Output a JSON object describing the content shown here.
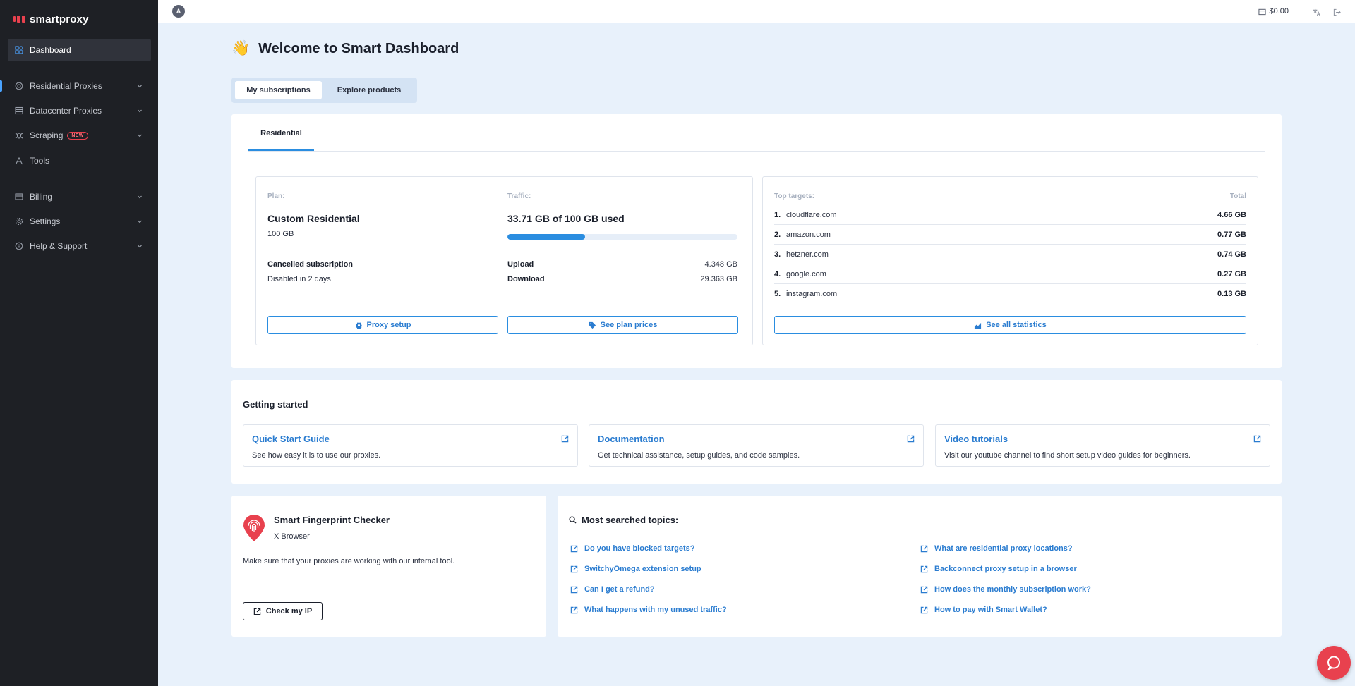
{
  "brand": {
    "name": "smartproxy",
    "accent": "#e8414e",
    "link_color": "#2a7cd0"
  },
  "sidebar": {
    "items": [
      {
        "label": "Dashboard",
        "icon": "dashboard-icon"
      },
      {
        "label": "Residential Proxies",
        "icon": "residential-icon"
      },
      {
        "label": "Datacenter Proxies",
        "icon": "datacenter-icon"
      },
      {
        "label": "Scraping",
        "icon": "scraping-icon",
        "badge": "NEW"
      },
      {
        "label": "Tools",
        "icon": "tools-icon"
      },
      {
        "label": "Billing",
        "icon": "billing-icon"
      },
      {
        "label": "Settings",
        "icon": "settings-icon"
      },
      {
        "label": "Help & Support",
        "icon": "help-icon"
      }
    ]
  },
  "topbar": {
    "avatar_initial": "A",
    "balance": "$0.00"
  },
  "welcome": {
    "emoji": "👋",
    "title": "Welcome to Smart Dashboard"
  },
  "tabs": [
    "My subscriptions",
    "Explore products"
  ],
  "subscription": {
    "subtab": "Residential",
    "plan_label": "Plan:",
    "plan_name": "Custom Residential",
    "plan_size": "100 GB",
    "status_title": "Cancelled subscription",
    "status_text": "Disabled in 2 days",
    "traffic_label": "Traffic:",
    "traffic_used": "33.71 GB of 100 GB used",
    "traffic_fraction": 0.3371,
    "upload_label": "Upload",
    "upload_value": "4.348 GB",
    "download_label": "Download",
    "download_value": "29.363 GB",
    "proxy_setup_button": "Proxy setup",
    "plan_prices_button": "See plan prices",
    "targets_label": "Top targets:",
    "total_label": "Total",
    "targets": [
      {
        "num": "1.",
        "domain": "cloudflare.com",
        "value": "4.66 GB"
      },
      {
        "num": "2.",
        "domain": "amazon.com",
        "value": "0.77 GB"
      },
      {
        "num": "3.",
        "domain": "hetzner.com",
        "value": "0.74 GB"
      },
      {
        "num": "4.",
        "domain": "google.com",
        "value": "0.27 GB"
      },
      {
        "num": "5.",
        "domain": "instagram.com",
        "value": "0.13 GB"
      }
    ],
    "stats_button": "See all statistics"
  },
  "getting_started": {
    "title": "Getting started",
    "cards": [
      {
        "title": "Quick Start Guide",
        "desc": "See how easy it is to use our proxies."
      },
      {
        "title": "Documentation",
        "desc": "Get technical assistance, setup guides, and code samples."
      },
      {
        "title": "Video tutorials",
        "desc": "Visit our youtube channel to find short setup video guides for beginners."
      }
    ]
  },
  "fingerprint": {
    "title": "Smart Fingerprint Checker",
    "subtitle": "X Browser",
    "desc": "Make sure that your proxies are working with our internal tool.",
    "button": "Check my IP"
  },
  "topics": {
    "title": "Most searched topics:",
    "items": [
      "Do you have blocked targets?",
      "SwitchyOmega extension setup",
      "Can I get a refund?",
      "What happens with my unused traffic?",
      "What are residential proxy locations?",
      "Backconnect proxy setup in a browser",
      "How does the monthly subscription work?",
      "How to pay with Smart Wallet?"
    ]
  }
}
